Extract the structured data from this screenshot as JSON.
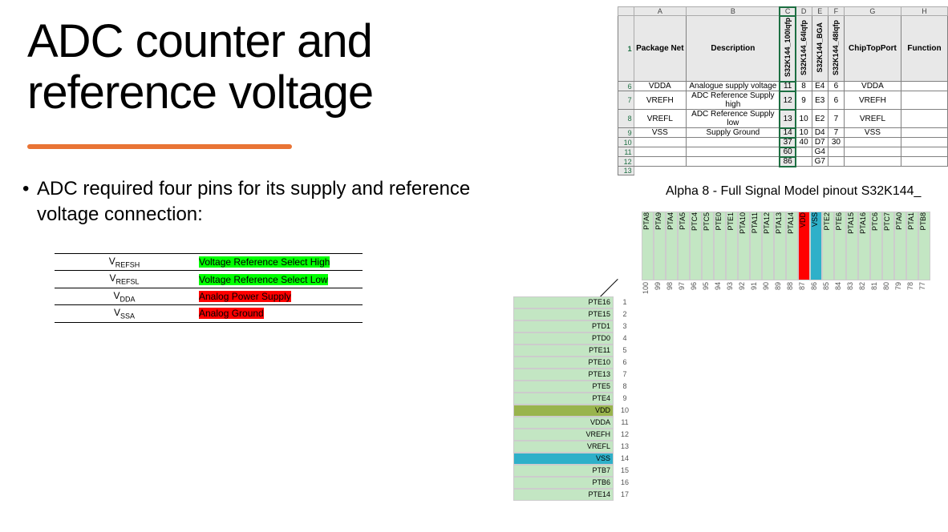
{
  "title_line1": "ADC counter and",
  "title_line2": "reference voltage",
  "bullet": "ADC required four pins for its supply and reference voltage connection:",
  "sig_table": [
    {
      "sym": "V",
      "sub": "REFSH",
      "desc": "Voltage Reference Select High",
      "cls": "hl-green"
    },
    {
      "sym": "V",
      "sub": "REFSL",
      "desc": "Voltage Reference Select Low",
      "cls": "hl-green"
    },
    {
      "sym": "V",
      "sub": "DDA",
      "desc": "Analog Power Supply",
      "cls": "hl-red"
    },
    {
      "sym": "V",
      "sub": "SSA",
      "desc": "Analog Ground",
      "cls": "hl-red"
    }
  ],
  "pkg": {
    "col_letters": [
      "A",
      "B",
      "C",
      "D",
      "E",
      "F",
      "G",
      "H"
    ],
    "head": {
      "A": "Package Net",
      "B": "Description",
      "C": "S32K144_100lqfp",
      "D": "S32K144_64lqfp",
      "E": "S32K144_BGA",
      "F": "S32K144_48lqfp",
      "G": "ChipTopPort",
      "H": "Function"
    },
    "rows": [
      {
        "n": "6",
        "A": "VDDA",
        "B": "Analogue supply voltage",
        "C": "11",
        "D": "8",
        "E": "E4",
        "F": "6",
        "G": "VDDA",
        "H": ""
      },
      {
        "n": "7",
        "A": "VREFH",
        "B": "ADC Reference Supply high",
        "C": "12",
        "D": "9",
        "E": "E3",
        "F": "6",
        "G": "VREFH",
        "H": ""
      },
      {
        "n": "8",
        "A": "VREFL",
        "B": "ADC Reference Supply low",
        "C": "13",
        "D": "10",
        "E": "E2",
        "F": "7",
        "G": "VREFL",
        "H": ""
      },
      {
        "n": "9",
        "A": "VSS",
        "B": "Supply Ground",
        "C": "14",
        "D": "10",
        "E": "D4",
        "F": "7",
        "G": "VSS",
        "H": ""
      },
      {
        "n": "10",
        "A": "",
        "B": "",
        "C": "37",
        "D": "40",
        "E": "D7",
        "F": "30",
        "G": "",
        "H": ""
      },
      {
        "n": "11",
        "A": "",
        "B": "",
        "C": "60",
        "D": "",
        "E": "G4",
        "F": "",
        "G": "",
        "H": ""
      },
      {
        "n": "12",
        "A": "",
        "B": "",
        "C": "86",
        "D": "",
        "E": "G7",
        "F": "",
        "G": "",
        "H": ""
      }
    ],
    "trailing_row": "13"
  },
  "pinout": {
    "title": "Alpha 8 - Full Signal Model pinout S32K144_",
    "top": [
      {
        "sig": "PTA8",
        "n": "100",
        "cls": ""
      },
      {
        "sig": "PTA9",
        "n": "99",
        "cls": ""
      },
      {
        "sig": "PTA4",
        "n": "98",
        "cls": ""
      },
      {
        "sig": "PTA5",
        "n": "97",
        "cls": ""
      },
      {
        "sig": "PTC4",
        "n": "96",
        "cls": ""
      },
      {
        "sig": "PTC5",
        "n": "95",
        "cls": ""
      },
      {
        "sig": "PTE0",
        "n": "94",
        "cls": ""
      },
      {
        "sig": "PTE1",
        "n": "93",
        "cls": ""
      },
      {
        "sig": "PTA10",
        "n": "92",
        "cls": ""
      },
      {
        "sig": "PTA11",
        "n": "91",
        "cls": ""
      },
      {
        "sig": "PTA12",
        "n": "90",
        "cls": ""
      },
      {
        "sig": "PTA13",
        "n": "89",
        "cls": ""
      },
      {
        "sig": "PTA14",
        "n": "88",
        "cls": ""
      },
      {
        "sig": "VDD",
        "n": "87",
        "cls": "c-red"
      },
      {
        "sig": "VSS",
        "n": "86",
        "cls": "c-teal"
      },
      {
        "sig": "PTE2",
        "n": "85",
        "cls": ""
      },
      {
        "sig": "PTE6",
        "n": "84",
        "cls": ""
      },
      {
        "sig": "PTA15",
        "n": "83",
        "cls": ""
      },
      {
        "sig": "PTA16",
        "n": "82",
        "cls": ""
      },
      {
        "sig": "PTC6",
        "n": "81",
        "cls": ""
      },
      {
        "sig": "PTC7",
        "n": "80",
        "cls": ""
      },
      {
        "sig": "PTA0",
        "n": "79",
        "cls": ""
      },
      {
        "sig": "PTA1",
        "n": "78",
        "cls": ""
      },
      {
        "sig": "PTB8",
        "n": "77",
        "cls": ""
      }
    ],
    "left": [
      {
        "sig": "PTE16",
        "n": "1",
        "cls": "",
        "wide": false
      },
      {
        "sig": "PTE15",
        "n": "2",
        "cls": "",
        "wide": false
      },
      {
        "sig": "PTD1",
        "n": "3",
        "cls": "",
        "wide": false
      },
      {
        "sig": "PTD0",
        "n": "4",
        "cls": "",
        "wide": false
      },
      {
        "sig": "PTE11",
        "n": "5",
        "cls": "",
        "wide": false
      },
      {
        "sig": "PTE10",
        "n": "6",
        "cls": "",
        "wide": false
      },
      {
        "sig": "PTE13",
        "n": "7",
        "cls": "",
        "wide": false
      },
      {
        "sig": "PTE5",
        "n": "8",
        "cls": "",
        "wide": false
      },
      {
        "sig": "PTE4",
        "n": "9",
        "cls": "",
        "wide": false
      },
      {
        "sig": "VDD",
        "n": "10",
        "cls": "c-olive",
        "wide": false
      },
      {
        "sig": "VDDA",
        "n": "11",
        "cls": "",
        "wide": true
      },
      {
        "sig": "VREFH",
        "n": "12",
        "cls": "",
        "wide": true
      },
      {
        "sig": "VREFL",
        "n": "13",
        "cls": "",
        "wide": true
      },
      {
        "sig": "VSS",
        "n": "14",
        "cls": "c-teal",
        "wide": true
      },
      {
        "sig": "PTB7",
        "n": "15",
        "cls": "",
        "wide": false
      },
      {
        "sig": "PTB6",
        "n": "16",
        "cls": "",
        "wide": false
      },
      {
        "sig": "PTE14",
        "n": "17",
        "cls": "",
        "wide": false
      }
    ]
  }
}
